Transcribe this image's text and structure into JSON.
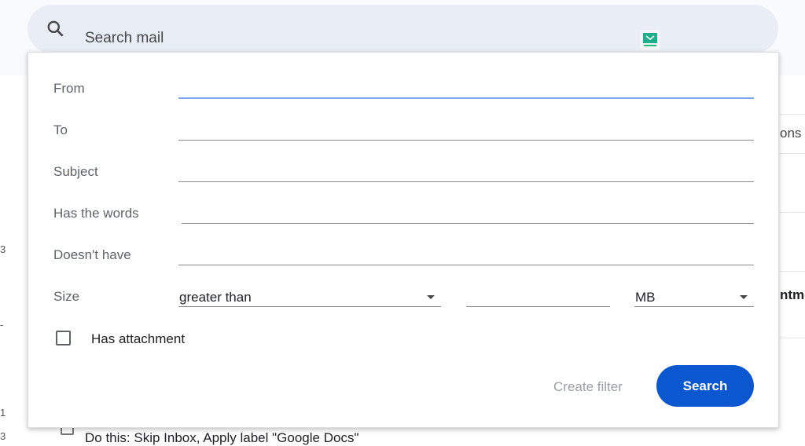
{
  "search": {
    "placeholder": "Search mail"
  },
  "background": {
    "partial_texts": [
      "ons",
      "ntme"
    ],
    "bottom_row": "Do this: Skip Inbox, Apply label \"Google Docs\"",
    "left_chars": [
      "3",
      "-",
      "1",
      "3"
    ]
  },
  "advanced_search": {
    "fields": [
      {
        "label": "From",
        "value": ""
      },
      {
        "label": "To",
        "value": ""
      },
      {
        "label": "Subject",
        "value": ""
      },
      {
        "label": "Has the words",
        "value": ""
      },
      {
        "label": "Doesn't have",
        "value": ""
      }
    ],
    "size": {
      "label": "Size",
      "operator": "greater than",
      "value": "",
      "unit": "MB"
    },
    "has_attachment": {
      "label": "Has attachment",
      "checked": false
    },
    "create_filter_label": "Create filter",
    "search_label": "Search"
  },
  "colors": {
    "accent": "#0b57d0",
    "focus_underline": "#7aa7f2",
    "extension": "#1fae8c"
  },
  "icons": [
    "search-icon",
    "tempmail-extension-icon",
    "dropdown-arrow-icon",
    "checkbox-icon"
  ]
}
